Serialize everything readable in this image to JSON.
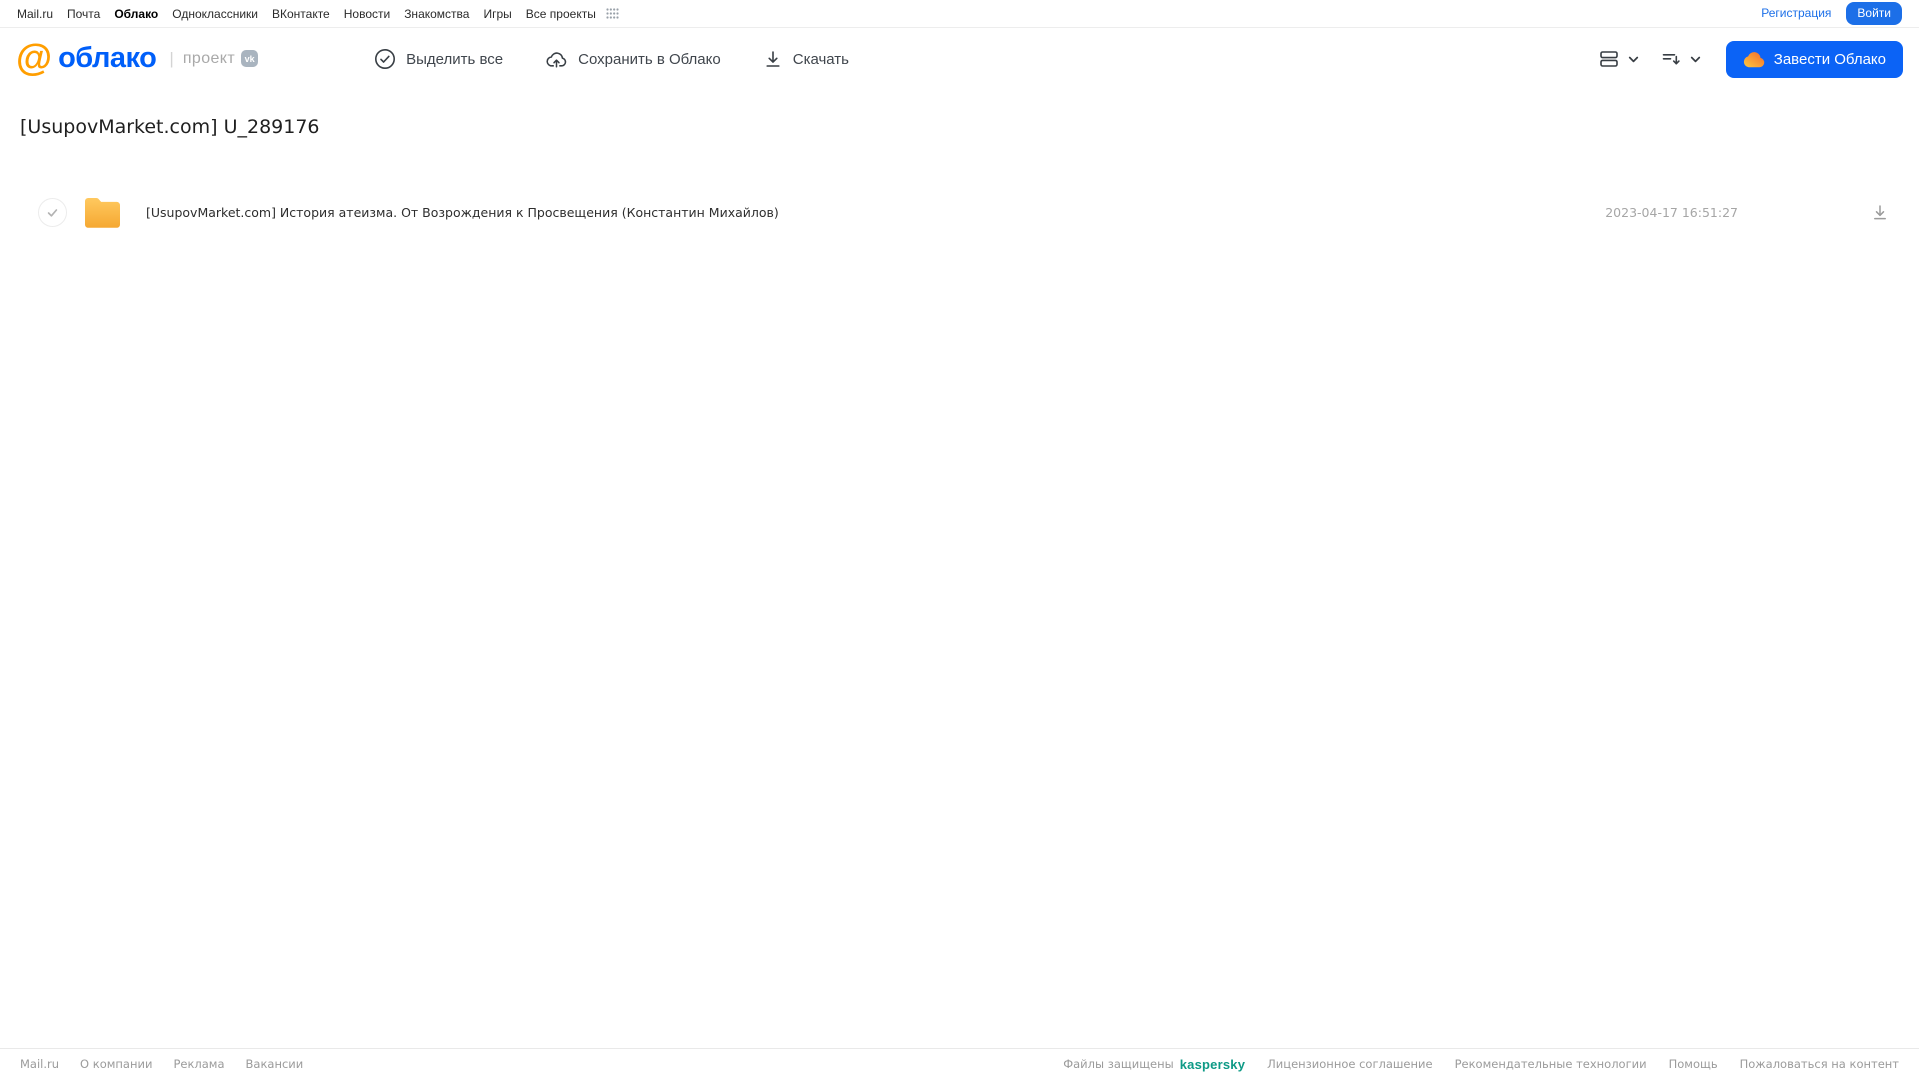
{
  "topnav": {
    "links": [
      {
        "label": "Mail.ru"
      },
      {
        "label": "Почта"
      },
      {
        "label": "Облако"
      },
      {
        "label": "Одноклассники"
      },
      {
        "label": "ВКонтакте"
      },
      {
        "label": "Новости"
      },
      {
        "label": "Знакомства"
      },
      {
        "label": "Игры"
      },
      {
        "label": "Все проекты"
      }
    ],
    "register_label": "Регистрация",
    "login_label": "Войти"
  },
  "header": {
    "logo": {
      "at_symbol": "@",
      "text": "облако",
      "divider": "|",
      "project_label": "проект",
      "vk_badge": "vk"
    },
    "toolbar": {
      "select_all_label": "Выделить все",
      "save_to_cloud_label": "Сохранить в Облако",
      "download_label": "Скачать"
    },
    "get_cloud_button_label": "Завести Облако"
  },
  "main": {
    "page_title": "[UsupovMarket.com] U_289176",
    "files": [
      {
        "type": "folder",
        "name": "[UsupovMarket.com] История атеизма. От Возрождения к Просвещения (Константин Михайлов)",
        "modified": "2023-04-17 16:51:27"
      }
    ]
  },
  "footer": {
    "links_left": [
      {
        "label": "Mail.ru"
      },
      {
        "label": "О компании"
      },
      {
        "label": "Реклама"
      },
      {
        "label": "Вакансии"
      }
    ],
    "protected_by_label": "Файлы защищены",
    "kaspersky_label": "kaspersky",
    "links_right": [
      {
        "label": "Лицензионное соглашение"
      },
      {
        "label": "Рекомендательные технологии"
      },
      {
        "label": "Помощь"
      },
      {
        "label": "Пожаловаться на контент"
      }
    ]
  },
  "colors": {
    "accent_blue": "#0B63F6",
    "logo_blue": "#005FF9",
    "logo_orange": "#FF9E00",
    "folder_top": "#FFC95F",
    "folder_bottom": "#F5A832",
    "kaspersky_teal": "#0E9A86"
  }
}
